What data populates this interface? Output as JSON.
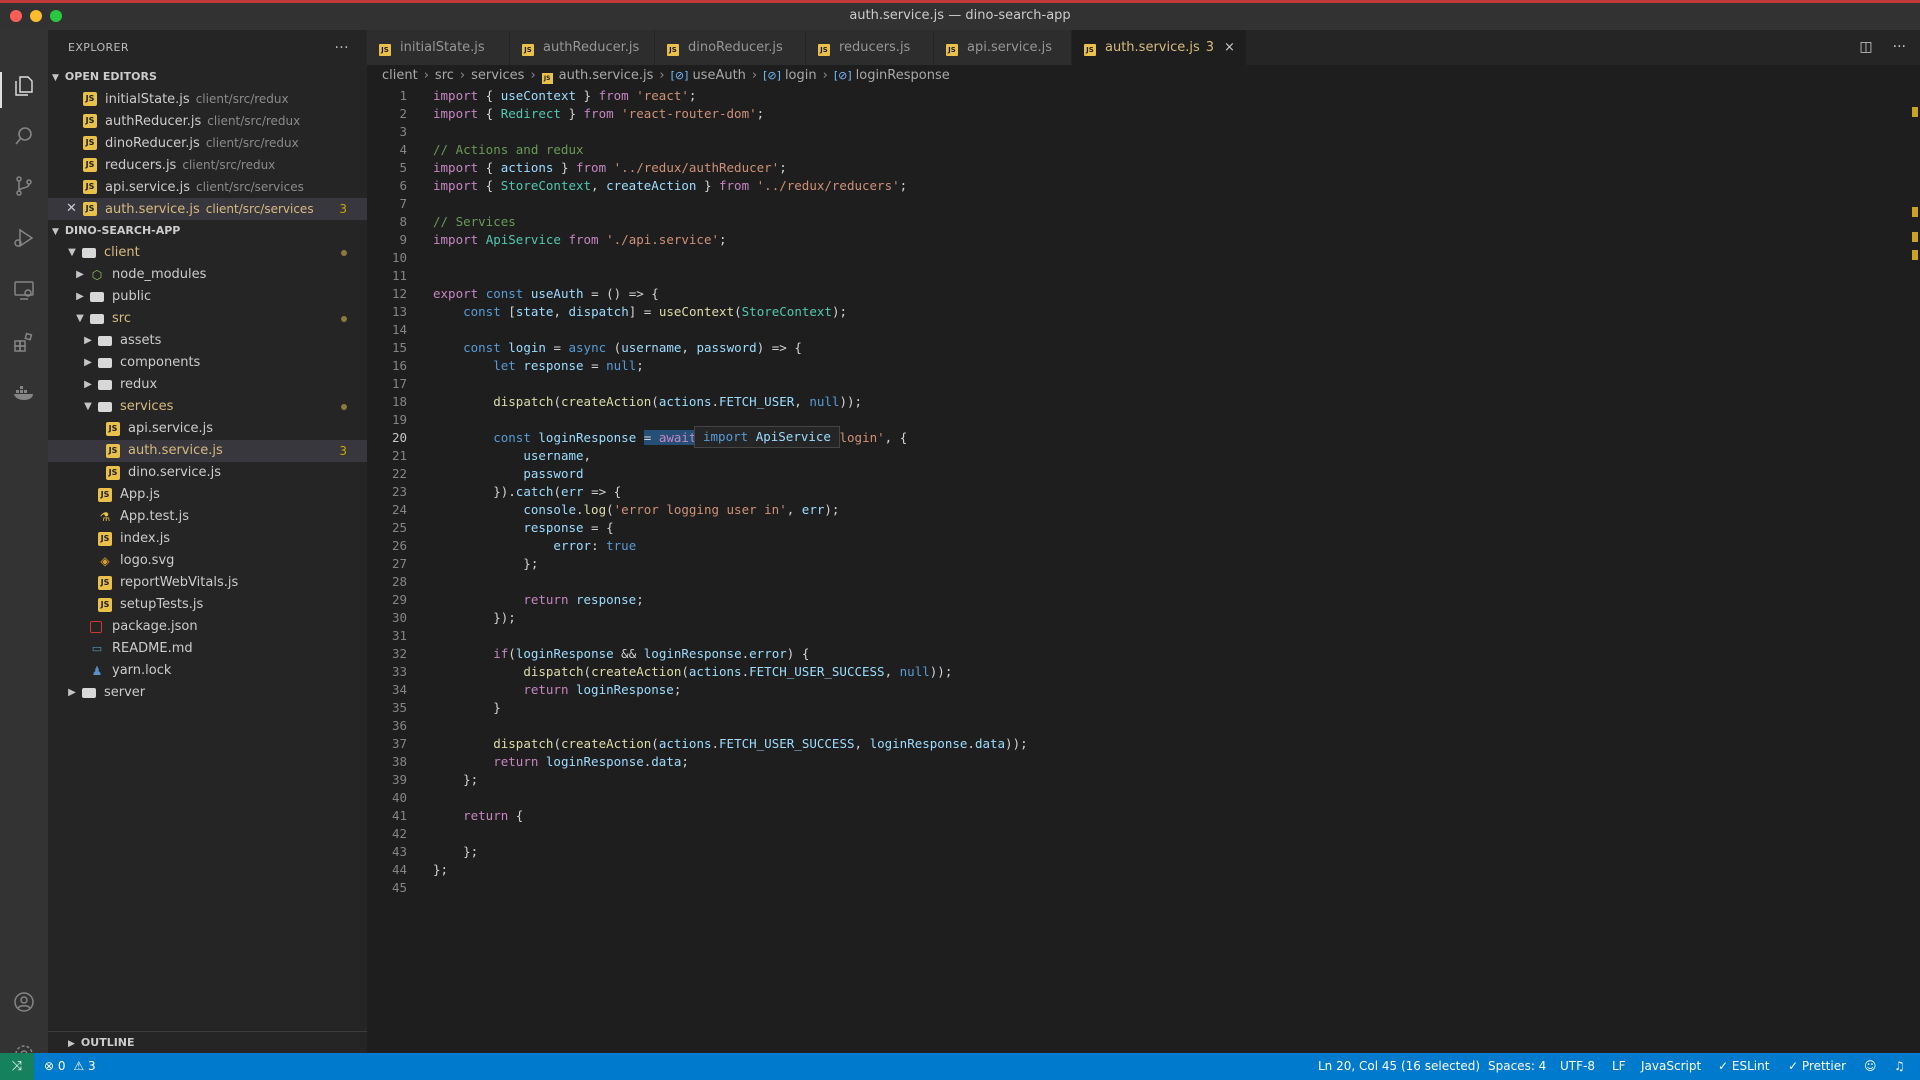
{
  "window": {
    "title": "auth.service.js — dino-search-app"
  },
  "colors": {
    "close": "#ff5f57",
    "minimize": "#febc2e",
    "zoom": "#28c840",
    "status_bar": "#007acc",
    "selection": "#264f78"
  },
  "activity_bar": {
    "icons": [
      "explorer-icon",
      "search-icon",
      "source-control-icon",
      "run-debug-icon",
      "remote-explorer-icon",
      "extensions-icon",
      "docker-icon",
      "account-icon",
      "settings-gear-icon"
    ]
  },
  "sidebar": {
    "title": "EXPLORER",
    "more": "···",
    "open_editors_title": "OPEN EDITORS",
    "open_editors": [
      {
        "name": "initialState.js",
        "path": "client/src/redux"
      },
      {
        "name": "authReducer.js",
        "path": "client/src/redux"
      },
      {
        "name": "dinoReducer.js",
        "path": "client/src/redux"
      },
      {
        "name": "reducers.js",
        "path": "client/src/redux"
      },
      {
        "name": "api.service.js",
        "path": "client/src/services"
      },
      {
        "name": "auth.service.js",
        "path": "client/src/services",
        "badge": "3"
      }
    ],
    "project_title": "DINO-SEARCH-APP",
    "tree": [
      {
        "name": "client"
      },
      {
        "name": "node_modules"
      },
      {
        "name": "public"
      },
      {
        "name": "src"
      },
      {
        "name": "assets"
      },
      {
        "name": "components"
      },
      {
        "name": "redux"
      },
      {
        "name": "services"
      },
      {
        "name": "api.service.js"
      },
      {
        "name": "auth.service.js",
        "badge": "3"
      },
      {
        "name": "dino.service.js"
      },
      {
        "name": "App.js"
      },
      {
        "name": "App.test.js"
      },
      {
        "name": "index.js"
      },
      {
        "name": "logo.svg"
      },
      {
        "name": "reportWebVitals.js"
      },
      {
        "name": "setupTests.js"
      },
      {
        "name": "package.json"
      },
      {
        "name": "README.md"
      },
      {
        "name": "yarn.lock"
      },
      {
        "name": "server"
      }
    ],
    "outline": "OUTLINE"
  },
  "tabs": [
    {
      "label": "initialState.js"
    },
    {
      "label": "authReducer.js"
    },
    {
      "label": "dinoReducer.js"
    },
    {
      "label": "reducers.js"
    },
    {
      "label": "api.service.js"
    },
    {
      "label": "auth.service.js",
      "badge": "3",
      "close": "×"
    }
  ],
  "breadcrumb": [
    "client",
    "src",
    "services",
    "auth.service.js",
    "useAuth",
    "login",
    "loginResponse"
  ],
  "hover_tooltip": {
    "keyword": "import",
    "name": "ApiService"
  },
  "code_lines": [
    "import { useContext } from 'react';",
    "import { Redirect } from 'react-router-dom';",
    "",
    "// Actions and redux",
    "import { actions } from '../redux/authReducer';",
    "import { StoreContext, createAction } from '../redux/reducers';",
    "",
    "// Services",
    "import ApiService from './api.service';",
    "",
    "",
    "export const useAuth = () => {",
    "    const [state, dispatch] = useContext(StoreContext);",
    "",
    "    const login = async (username, password) => {",
    "        let response = null;",
    "",
    "        dispatch(createAction(actions.FETCH_USER, null));",
    "",
    "        const loginResponse = await ApiService.post('/login', {",
    "            username,",
    "            password",
    "        }).catch(err => {",
    "            console.log('error logging user in', err);",
    "            response = {",
    "                error: true",
    "            };",
    "",
    "            return response;",
    "        });",
    "",
    "        if(loginResponse && loginResponse.error) {",
    "            dispatch(createAction(actions.FETCH_USER_SUCCESS, null));",
    "            return loginResponse;",
    "        }",
    "",
    "        dispatch(createAction(actions.FETCH_USER_SUCCESS, loginResponse.data));",
    "        return loginResponse.data;",
    "    };",
    "",
    "    return {",
    "",
    "    };",
    "};",
    ""
  ],
  "status_bar": {
    "remote": "⤨",
    "errors": "0",
    "warnings": "3",
    "cursor": "Ln 20, Col 45 (16 selected)",
    "spaces": "Spaces: 4",
    "encoding": "UTF-8",
    "eol": "LF",
    "language": "JavaScript",
    "eslint": "ESLint",
    "prettier": "Prettier"
  }
}
